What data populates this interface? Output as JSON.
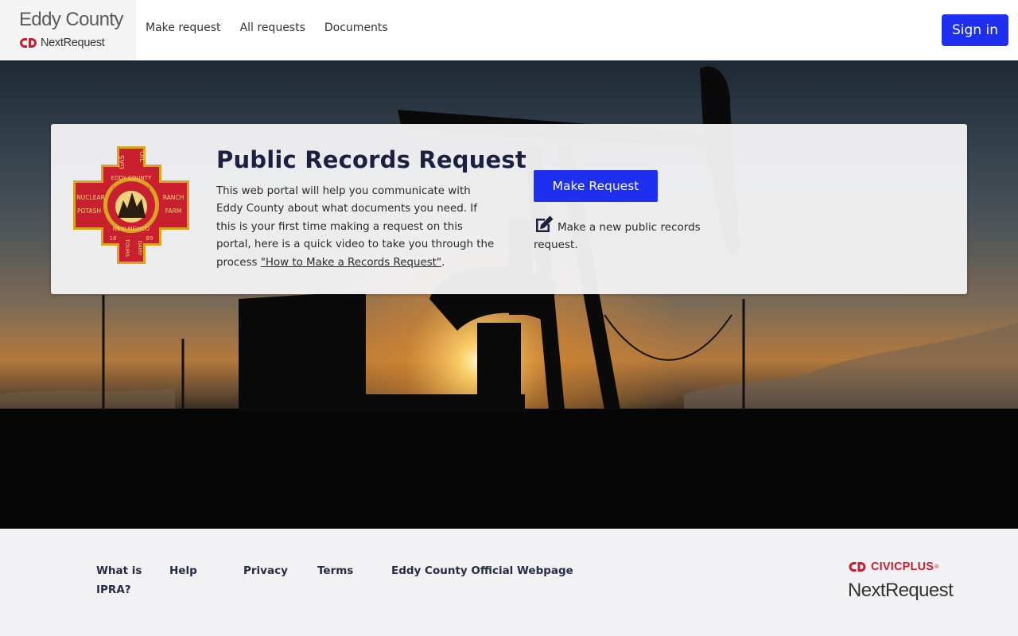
{
  "brand": {
    "county_name": "Eddy County",
    "product_name": "NextRequest"
  },
  "nav": {
    "links": [
      "Make request",
      "All requests",
      "Documents"
    ],
    "signin_label": "Sign in"
  },
  "seal": {
    "top": "GAS",
    "top_right": "OIL",
    "ring_top": "EDDY COUNTY",
    "inner": "CARLSBAD CAVERNS",
    "left_top": "NUCLEAR",
    "left_bottom": "POTASH",
    "right_top": "RANCH",
    "right_bottom": "FARM",
    "ring_bottom": "NEW MEXICO",
    "year_left": "18",
    "year_right": "89",
    "bottom_left": "TOURS",
    "bottom_right": "DAIRY",
    "colors": {
      "red": "#c8202f",
      "gold": "#d9a520",
      "dark": "#2b1d10"
    }
  },
  "card": {
    "title": "Public Records Request",
    "description": "This web portal will help you communicate with Eddy County about what documents you need. If this is your first time making a request on this portal, here is a quick video to take you through the process ",
    "video_link": "\"How to Make a Records Request\"",
    "period": ".",
    "make_request_label": "Make Request",
    "new_request_text": "Make a new public records request."
  },
  "footer": {
    "links": [
      "What is IPRA?",
      "Help",
      "Privacy",
      "Terms",
      "Eddy County Official Webpage"
    ],
    "civicplus": "CIVICPLUS",
    "trademark": "®",
    "nextrequest": "NextRequest"
  },
  "colors": {
    "primary_button": "#1e2ff0",
    "civicplus_red": "#c4202f",
    "title_navy": "#1a2140"
  }
}
